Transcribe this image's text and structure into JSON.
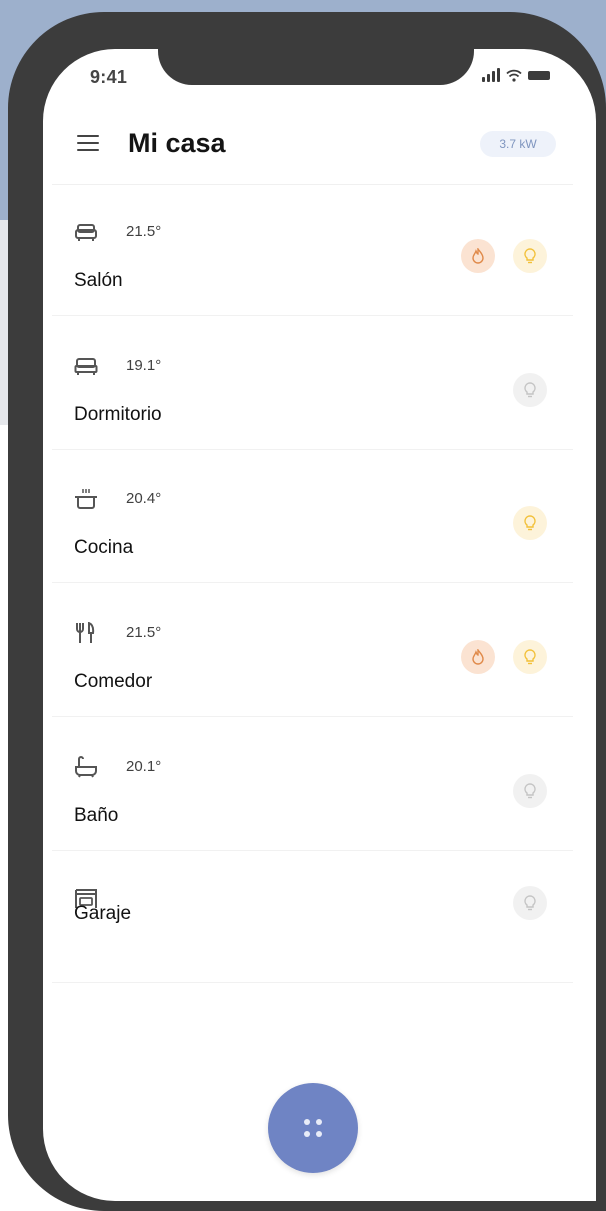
{
  "status_bar": {
    "time": "9:41"
  },
  "header": {
    "title": "Mi casa",
    "power": "3.7 kW"
  },
  "rooms": [
    {
      "name": "Salón",
      "temp": "21.5°",
      "icon": "sofa-icon",
      "heating": true,
      "light": "on"
    },
    {
      "name": "Dormitorio",
      "temp": "19.1°",
      "icon": "bed-icon",
      "heating": false,
      "light": "off"
    },
    {
      "name": "Cocina",
      "temp": "20.4°",
      "icon": "cooking-pot-icon",
      "heating": false,
      "light": "on"
    },
    {
      "name": "Comedor",
      "temp": "21.5°",
      "icon": "cutlery-icon",
      "heating": true,
      "light": "on"
    },
    {
      "name": "Baño",
      "temp": "20.1°",
      "icon": "bathtub-icon",
      "heating": false,
      "light": "off"
    },
    {
      "name": "Garaje",
      "temp": "",
      "icon": "garage-icon",
      "heating": false,
      "light": "off"
    }
  ],
  "colors": {
    "accent": "#6f84c4",
    "heating_bg": "#fbe3d2",
    "heating_icon": "#e08a4a",
    "light_on_bg": "#fdf3da",
    "light_on_icon": "#f2c038",
    "light_off_bg": "#f1f1f1",
    "light_off_icon": "#c4c4c4"
  },
  "fab": {
    "icon": "grid-dots-icon"
  }
}
